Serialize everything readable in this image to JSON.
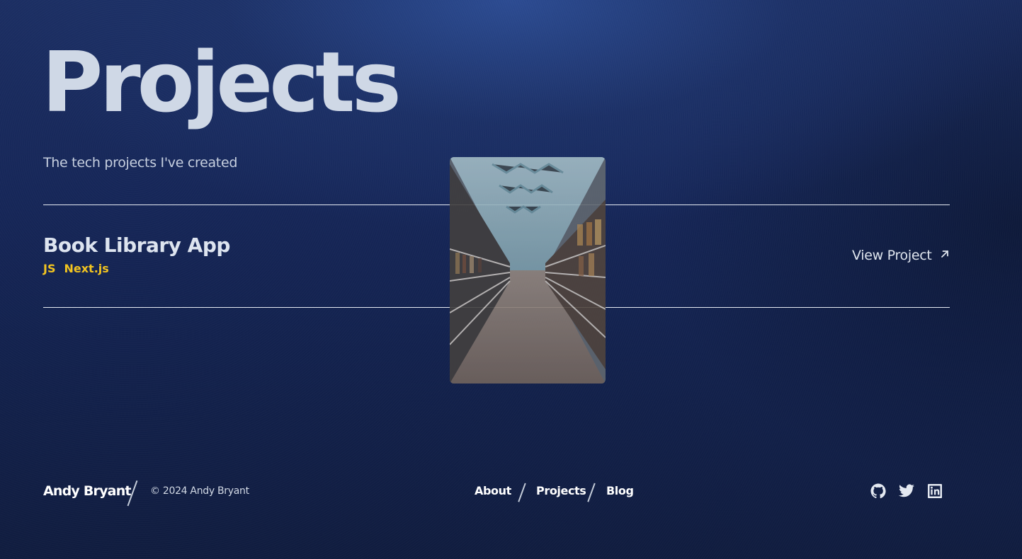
{
  "header": {
    "title": "Projects",
    "subtitle": "The tech projects I've created"
  },
  "projects": [
    {
      "name": "Book Library App",
      "tags": [
        "JS",
        "Next.js"
      ],
      "link_label": "View Project",
      "link_icon": "arrow-up-right-icon",
      "preview_image": "library-bookshelves-photo"
    }
  ],
  "footer": {
    "name": "Andy Bryant",
    "copyright": "© 2024 Andy Bryant",
    "nav": [
      "About",
      "Projects",
      "Blog"
    ],
    "socials": [
      "github-icon",
      "twitter-icon",
      "linkedin-icon"
    ]
  },
  "colors": {
    "accent_tag": "#f2c420",
    "background": "#17285a",
    "text": "#d4ddeb"
  }
}
